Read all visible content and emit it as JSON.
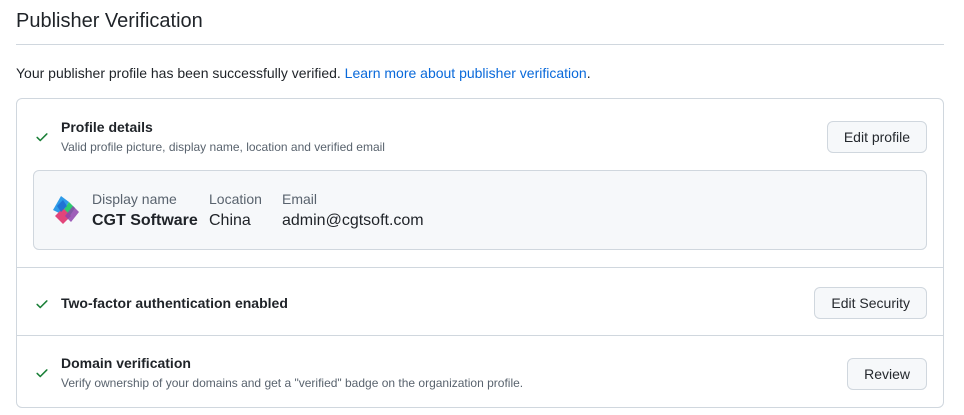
{
  "page": {
    "title": "Publisher Verification",
    "intro_text": "Your publisher profile has been successfully verified.",
    "intro_link": "Learn more about publisher verification",
    "intro_period": "."
  },
  "sections": {
    "profile": {
      "title": "Profile details",
      "description": "Valid profile picture, display name, location and verified email",
      "button_label": "Edit profile",
      "card": {
        "display_name_label": "Display name",
        "display_name": "CGT Software",
        "location_label": "Location",
        "location": "China",
        "email_label": "Email",
        "email": "admin@cgtsoft.com"
      }
    },
    "two_factor": {
      "title": "Two-factor authentication enabled",
      "button_label": "Edit Security"
    },
    "domain": {
      "title": "Domain verification",
      "description": "Verify ownership of your domains and get a \"verified\" badge on the organization profile.",
      "button_label": "Review"
    }
  },
  "colors": {
    "check": "#1a7f37",
    "link": "#0969da",
    "border": "#d0d7de",
    "muted_text": "#59636e",
    "card_bg": "#f6f8fa"
  },
  "icons": {
    "check": "check-icon",
    "logo": "cgt-logo-icon"
  }
}
